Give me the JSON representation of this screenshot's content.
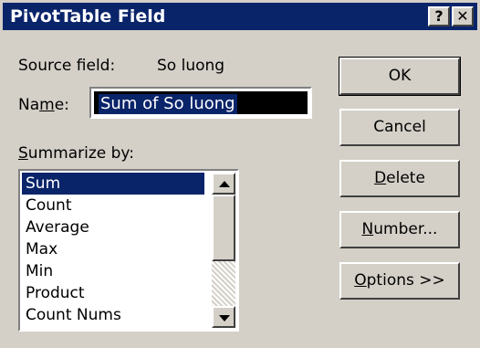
{
  "window": {
    "title": "PivotTable Field",
    "help_label": "?",
    "close_label": "✕"
  },
  "source_field": {
    "label": "Source field:",
    "value": "So luong"
  },
  "name_field": {
    "label_prefix": "Na",
    "label_underlined": "m",
    "label_suffix": "e:",
    "value": "Sum of So luong"
  },
  "summarize": {
    "label_underlined": "S",
    "label_rest": "ummarize by:",
    "items": [
      "Sum",
      "Count",
      "Average",
      "Max",
      "Min",
      "Product",
      "Count Nums"
    ],
    "selected_index": 0
  },
  "buttons": {
    "ok": "OK",
    "cancel": "Cancel",
    "delete_underlined": "D",
    "delete_rest": "elete",
    "number_underlined": "N",
    "number_rest": "umber...",
    "options_underlined": "O",
    "options_rest": "ptions >>"
  },
  "colors": {
    "titlebar": "#0a246a",
    "face": "#d4d0c8",
    "selection": "#0a246a"
  }
}
